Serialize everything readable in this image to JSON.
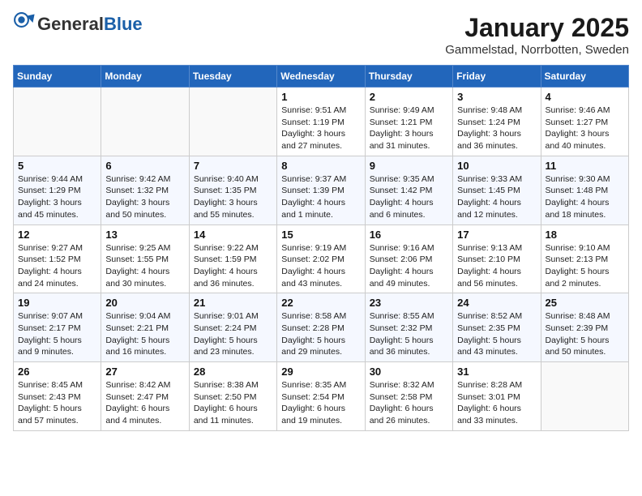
{
  "header": {
    "logo_general": "General",
    "logo_blue": "Blue",
    "month_title": "January 2025",
    "location": "Gammelstad, Norrbotten, Sweden"
  },
  "weekdays": [
    "Sunday",
    "Monday",
    "Tuesday",
    "Wednesday",
    "Thursday",
    "Friday",
    "Saturday"
  ],
  "weeks": [
    [
      {
        "day": "",
        "detail": ""
      },
      {
        "day": "",
        "detail": ""
      },
      {
        "day": "",
        "detail": ""
      },
      {
        "day": "1",
        "detail": "Sunrise: 9:51 AM\nSunset: 1:19 PM\nDaylight: 3 hours and 27 minutes."
      },
      {
        "day": "2",
        "detail": "Sunrise: 9:49 AM\nSunset: 1:21 PM\nDaylight: 3 hours and 31 minutes."
      },
      {
        "day": "3",
        "detail": "Sunrise: 9:48 AM\nSunset: 1:24 PM\nDaylight: 3 hours and 36 minutes."
      },
      {
        "day": "4",
        "detail": "Sunrise: 9:46 AM\nSunset: 1:27 PM\nDaylight: 3 hours and 40 minutes."
      }
    ],
    [
      {
        "day": "5",
        "detail": "Sunrise: 9:44 AM\nSunset: 1:29 PM\nDaylight: 3 hours and 45 minutes."
      },
      {
        "day": "6",
        "detail": "Sunrise: 9:42 AM\nSunset: 1:32 PM\nDaylight: 3 hours and 50 minutes."
      },
      {
        "day": "7",
        "detail": "Sunrise: 9:40 AM\nSunset: 1:35 PM\nDaylight: 3 hours and 55 minutes."
      },
      {
        "day": "8",
        "detail": "Sunrise: 9:37 AM\nSunset: 1:39 PM\nDaylight: 4 hours and 1 minute."
      },
      {
        "day": "9",
        "detail": "Sunrise: 9:35 AM\nSunset: 1:42 PM\nDaylight: 4 hours and 6 minutes."
      },
      {
        "day": "10",
        "detail": "Sunrise: 9:33 AM\nSunset: 1:45 PM\nDaylight: 4 hours and 12 minutes."
      },
      {
        "day": "11",
        "detail": "Sunrise: 9:30 AM\nSunset: 1:48 PM\nDaylight: 4 hours and 18 minutes."
      }
    ],
    [
      {
        "day": "12",
        "detail": "Sunrise: 9:27 AM\nSunset: 1:52 PM\nDaylight: 4 hours and 24 minutes."
      },
      {
        "day": "13",
        "detail": "Sunrise: 9:25 AM\nSunset: 1:55 PM\nDaylight: 4 hours and 30 minutes."
      },
      {
        "day": "14",
        "detail": "Sunrise: 9:22 AM\nSunset: 1:59 PM\nDaylight: 4 hours and 36 minutes."
      },
      {
        "day": "15",
        "detail": "Sunrise: 9:19 AM\nSunset: 2:02 PM\nDaylight: 4 hours and 43 minutes."
      },
      {
        "day": "16",
        "detail": "Sunrise: 9:16 AM\nSunset: 2:06 PM\nDaylight: 4 hours and 49 minutes."
      },
      {
        "day": "17",
        "detail": "Sunrise: 9:13 AM\nSunset: 2:10 PM\nDaylight: 4 hours and 56 minutes."
      },
      {
        "day": "18",
        "detail": "Sunrise: 9:10 AM\nSunset: 2:13 PM\nDaylight: 5 hours and 2 minutes."
      }
    ],
    [
      {
        "day": "19",
        "detail": "Sunrise: 9:07 AM\nSunset: 2:17 PM\nDaylight: 5 hours and 9 minutes."
      },
      {
        "day": "20",
        "detail": "Sunrise: 9:04 AM\nSunset: 2:21 PM\nDaylight: 5 hours and 16 minutes."
      },
      {
        "day": "21",
        "detail": "Sunrise: 9:01 AM\nSunset: 2:24 PM\nDaylight: 5 hours and 23 minutes."
      },
      {
        "day": "22",
        "detail": "Sunrise: 8:58 AM\nSunset: 2:28 PM\nDaylight: 5 hours and 29 minutes."
      },
      {
        "day": "23",
        "detail": "Sunrise: 8:55 AM\nSunset: 2:32 PM\nDaylight: 5 hours and 36 minutes."
      },
      {
        "day": "24",
        "detail": "Sunrise: 8:52 AM\nSunset: 2:35 PM\nDaylight: 5 hours and 43 minutes."
      },
      {
        "day": "25",
        "detail": "Sunrise: 8:48 AM\nSunset: 2:39 PM\nDaylight: 5 hours and 50 minutes."
      }
    ],
    [
      {
        "day": "26",
        "detail": "Sunrise: 8:45 AM\nSunset: 2:43 PM\nDaylight: 5 hours and 57 minutes."
      },
      {
        "day": "27",
        "detail": "Sunrise: 8:42 AM\nSunset: 2:47 PM\nDaylight: 6 hours and 4 minutes."
      },
      {
        "day": "28",
        "detail": "Sunrise: 8:38 AM\nSunset: 2:50 PM\nDaylight: 6 hours and 11 minutes."
      },
      {
        "day": "29",
        "detail": "Sunrise: 8:35 AM\nSunset: 2:54 PM\nDaylight: 6 hours and 19 minutes."
      },
      {
        "day": "30",
        "detail": "Sunrise: 8:32 AM\nSunset: 2:58 PM\nDaylight: 6 hours and 26 minutes."
      },
      {
        "day": "31",
        "detail": "Sunrise: 8:28 AM\nSunset: 3:01 PM\nDaylight: 6 hours and 33 minutes."
      },
      {
        "day": "",
        "detail": ""
      }
    ]
  ]
}
